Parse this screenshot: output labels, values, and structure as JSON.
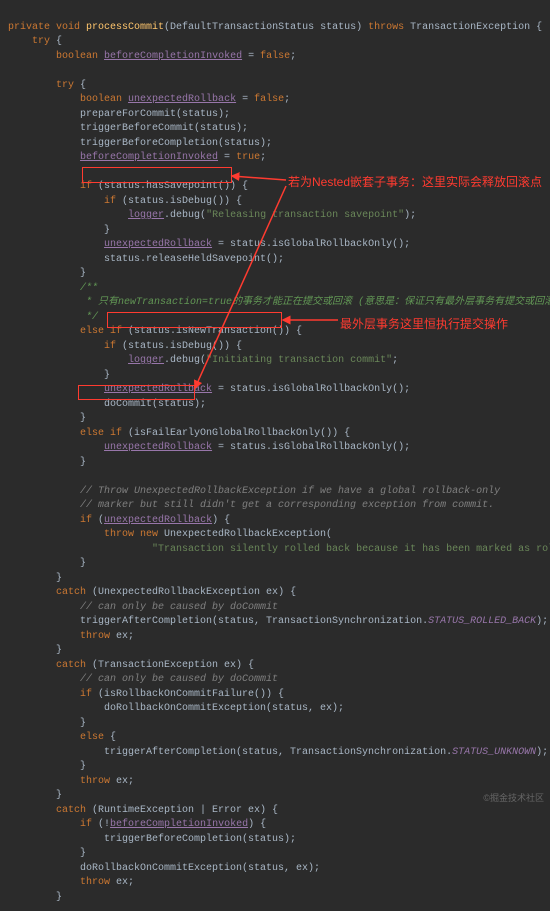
{
  "code": {
    "l1": "private void processCommit(DefaultTransactionStatus status) throws TransactionException {",
    "l2": "    try {",
    "l3": "        boolean beforeCompletionInvoked = false;",
    "l4": "",
    "l5": "        try {",
    "l6": "            boolean unexpectedRollback = false;",
    "l7": "            prepareForCommit(status);",
    "l8": "            triggerBeforeCommit(status);",
    "l9": "            triggerBeforeCompletion(status);",
    "l10": "            beforeCompletionInvoked = true;",
    "l11": "",
    "l12": "            if (status.hasSavepoint()) {",
    "l13": "                if (status.isDebug()) {",
    "l14": "                    logger.debug(\"Releasing transaction savepoint\");",
    "l15": "                }",
    "l16": "                unexpectedRollback = status.isGlobalRollbackOnly();",
    "l17": "                status.releaseHeldSavepoint();",
    "l18": "            }",
    "l19": "            /**",
    "l20": "             * 只有newTransaction=true的事务才能正在提交或回滚 (意思是：保证只有最外层事务有提交或回滚的权限)",
    "l21": "             */",
    "l22": "            else if (status.isNewTransaction()) {",
    "l23": "                if (status.isDebug()) {",
    "l24": "                    logger.debug(\"Initiating transaction commit\";",
    "l25": "                }",
    "l26": "                unexpectedRollback = status.isGlobalRollbackOnly();",
    "l27": "                doCommit(status);",
    "l28": "            }",
    "l29": "            else if (isFailEarlyOnGlobalRollbackOnly()) {",
    "l30": "                unexpectedRollback = status.isGlobalRollbackOnly();",
    "l31": "            }",
    "l32": "",
    "l33": "            // Throw UnexpectedRollbackException if we have a global rollback-only",
    "l34": "            // marker but still didn't get a corresponding exception from commit.",
    "l35": "            if (unexpectedRollback) {",
    "l36": "                throw new UnexpectedRollbackException(",
    "l37": "                        \"Transaction silently rolled back because it has been marked as rollback-o",
    "l38": "            }",
    "l39": "        }",
    "l40": "        catch (UnexpectedRollbackException ex) {",
    "l41": "            // can only be caused by doCommit",
    "l42": "            triggerAfterCompletion(status, TransactionSynchronization.STATUS_ROLLED_BACK);",
    "l43": "            throw ex;",
    "l44": "        }",
    "l45": "        catch (TransactionException ex) {",
    "l46": "            // can only be caused by doCommit",
    "l47": "            if (isRollbackOnCommitFailure()) {",
    "l48": "                doRollbackOnCommitException(status, ex);",
    "l49": "            }",
    "l50": "            else {",
    "l51": "                triggerAfterCompletion(status, TransactionSynchronization.STATUS_UNKNOWN);",
    "l52": "            }",
    "l53": "            throw ex;",
    "l54": "        }",
    "l55": "        catch (RuntimeException | Error ex) {",
    "l56": "            if (!beforeCompletionInvoked) {",
    "l57": "                triggerBeforeCompletion(status);",
    "l58": "            }",
    "l59": "            doRollbackOnCommitException(status, ex);",
    "l60": "            throw ex;",
    "l61": "        }"
  },
  "annotations": {
    "a1": "若为Nested嵌套子事务：这里实际会释放回滚点",
    "a2": "最外层事务这里恒执行提交操作"
  },
  "watermark": "©掘金技术社区"
}
